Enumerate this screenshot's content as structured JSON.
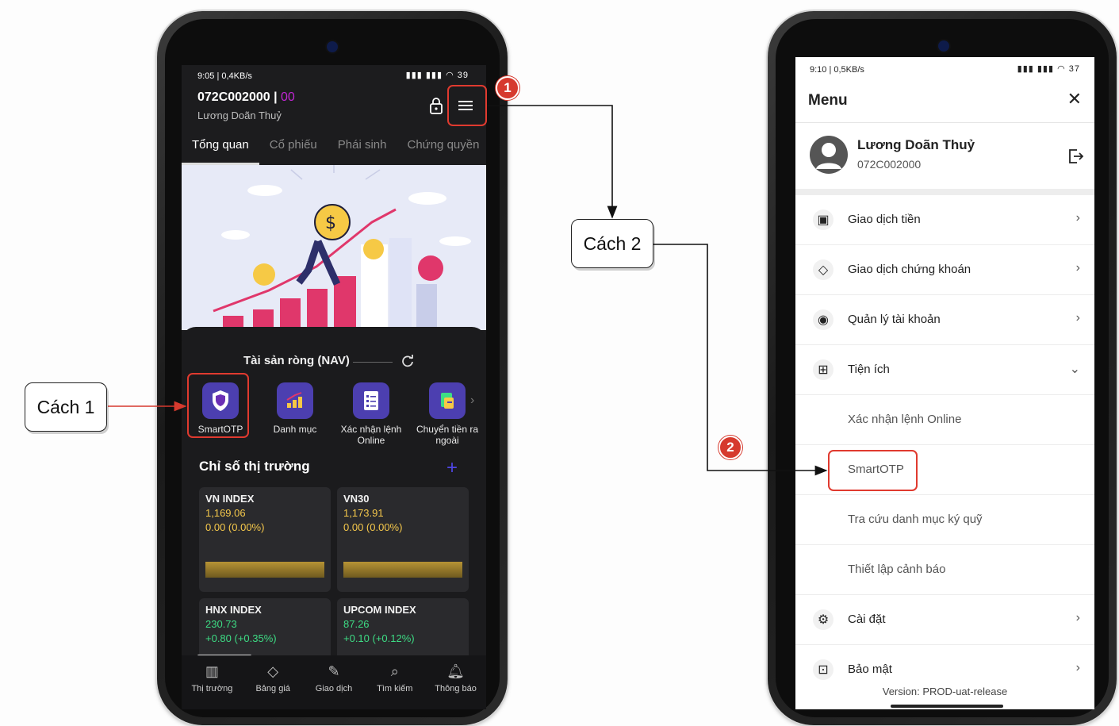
{
  "left_phone": {
    "status_time": "9:05 | 0,4KB/s",
    "status_battery": "39",
    "account_no": "072C002000",
    "account_sep": " | ",
    "account_sub": "00",
    "account_name": "Lương Doãn Thuỷ",
    "tabs": [
      "Tổng quan",
      "Cổ phiếu",
      "Phái sinh",
      "Chứng quyền"
    ],
    "nav_title": "Tài sản ròng (NAV)",
    "quick_actions": [
      "SmartOTP",
      "Danh mục",
      "Xác nhận lệnh Online",
      "Chuyển tiền ra ngoài"
    ],
    "market_title": "Chỉ số thị trường",
    "indices": [
      {
        "name": "VN INDEX",
        "value": "1,169.06",
        "change": "0.00 (0.00%)"
      },
      {
        "name": "VN30",
        "value": "1,173.91",
        "change": "0.00 (0.00%)"
      },
      {
        "name": "HNX INDEX",
        "value": "230.73",
        "change": "+0.80 (+0.35%)"
      },
      {
        "name": "UPCOM INDEX",
        "value": "87.26",
        "change": "+0.10 (+0.12%)"
      }
    ],
    "bottom_nav": [
      "Thị trường",
      "Bảng giá",
      "Giao dịch",
      "Tìm kiếm",
      "Thông báo"
    ]
  },
  "right_phone": {
    "status_time": "9:10 | 0,5KB/s",
    "status_battery": "37",
    "menu_title": "Menu",
    "close_glyph": "✕",
    "profile_name": "Lương Doãn Thuỷ",
    "profile_id": "072C002000",
    "items": [
      {
        "label": "Giao dịch tiền",
        "icon": "wallet-icon",
        "chevron": "›"
      },
      {
        "label": "Giao dịch chứng khoán",
        "icon": "tag-icon",
        "chevron": "›"
      },
      {
        "label": "Quản lý tài khoản",
        "icon": "user-circle-icon",
        "chevron": "›"
      },
      {
        "label": "Tiện ích",
        "icon": "grid-plus-icon",
        "chevron": "⌄"
      },
      {
        "label": "Xác nhận lệnh Online"
      },
      {
        "label": "SmartOTP"
      },
      {
        "label": "Tra cứu danh mục ký quỹ"
      },
      {
        "label": "Thiết lập cảnh báo"
      },
      {
        "label": "Cài đặt",
        "icon": "gear-icon",
        "chevron": "›"
      },
      {
        "label": "Bảo mật",
        "icon": "lock-icon",
        "chevron": "›"
      }
    ],
    "version": "Version: PROD-uat-release"
  },
  "callouts": {
    "method1": "Cách 1",
    "method2": "Cách 2",
    "badge1": "1",
    "badge2": "2"
  },
  "colors": {
    "highlight": "#e03a2f",
    "accent_purple": "#4c3fb0",
    "index_yellow": "#f5c84b",
    "index_green": "#3ddc84"
  }
}
